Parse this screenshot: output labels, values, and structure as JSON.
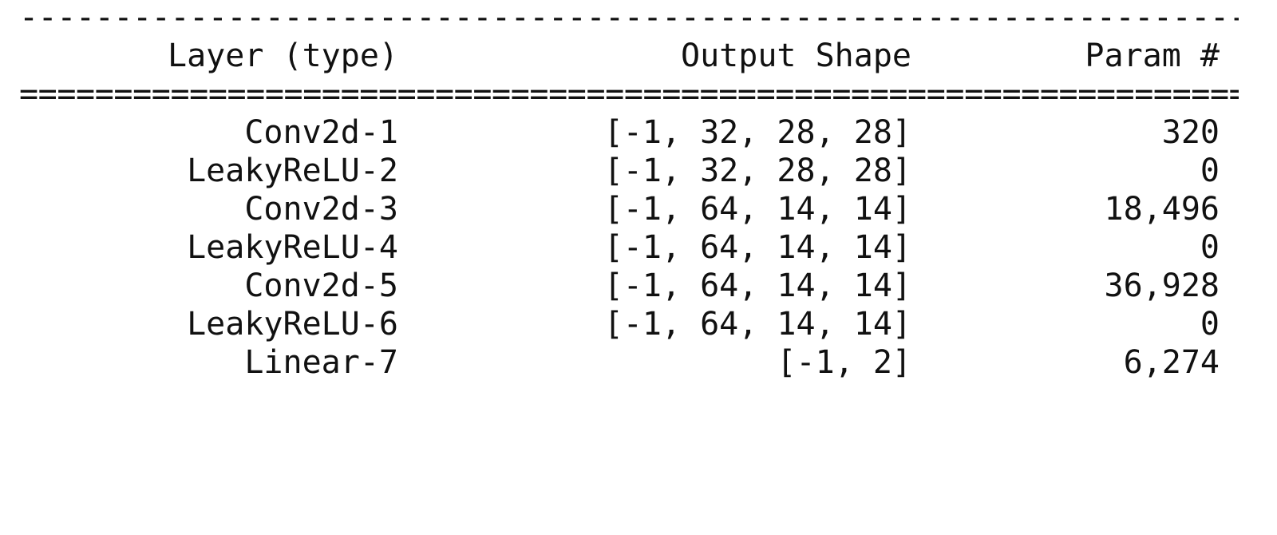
{
  "separators": {
    "top": "------------------------------------------------------------------------------------------------",
    "header": "================================================================================================"
  },
  "columns": {
    "layer": "Layer (type)",
    "output_shape": "Output Shape",
    "params": "Param #"
  },
  "rows": [
    {
      "layer": "Conv2d-1",
      "output_shape": "[-1, 32, 28, 28]",
      "params": "320"
    },
    {
      "layer": "LeakyReLU-2",
      "output_shape": "[-1, 32, 28, 28]",
      "params": "0"
    },
    {
      "layer": "Conv2d-3",
      "output_shape": "[-1, 64, 14, 14]",
      "params": "18,496"
    },
    {
      "layer": "LeakyReLU-4",
      "output_shape": "[-1, 64, 14, 14]",
      "params": "0"
    },
    {
      "layer": "Conv2d-5",
      "output_shape": "[-1, 64, 14, 14]",
      "params": "36,928"
    },
    {
      "layer": "LeakyReLU-6",
      "output_shape": "[-1, 64, 14, 14]",
      "params": "0"
    },
    {
      "layer": "Linear-7",
      "output_shape": "[-1, 2]",
      "params": "6,274"
    }
  ]
}
